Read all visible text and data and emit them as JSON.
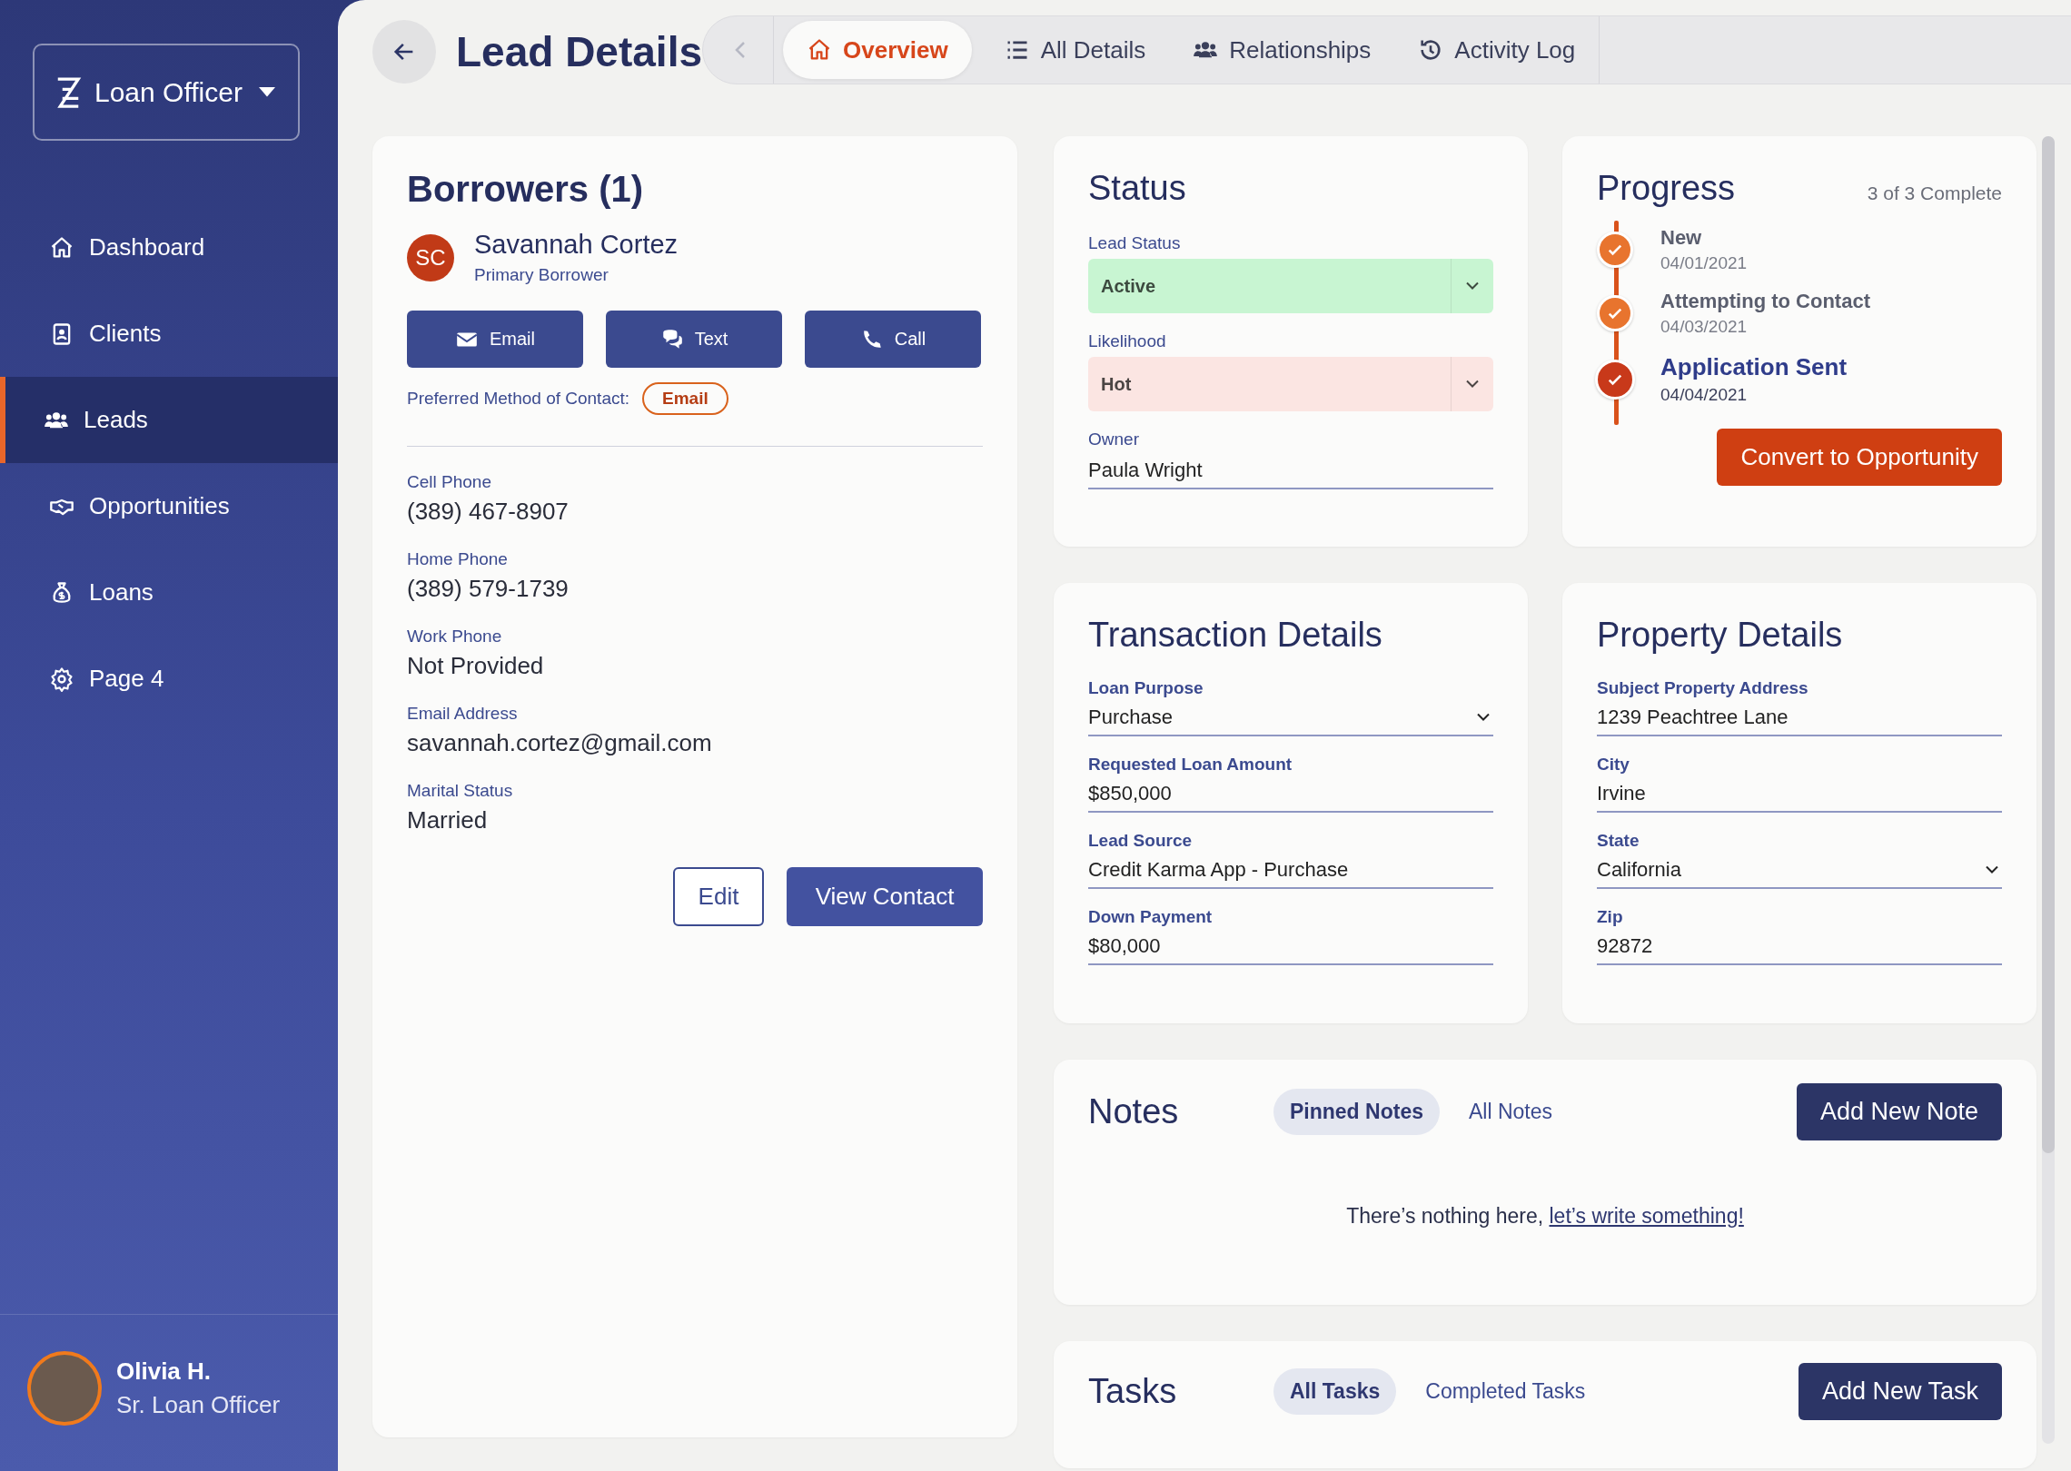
{
  "sidebar": {
    "brand": "Loan Officer",
    "items": [
      {
        "label": "Dashboard",
        "selected": false
      },
      {
        "label": "Clients",
        "selected": false
      },
      {
        "label": "Leads",
        "selected": true
      },
      {
        "label": "Opportunities",
        "selected": false
      },
      {
        "label": "Loans",
        "selected": false
      },
      {
        "label": "Page 4",
        "selected": false
      }
    ],
    "user": {
      "name": "Olivia H.",
      "role": "Sr. Loan Officer"
    }
  },
  "header": {
    "title": "Lead Details",
    "tabs": [
      {
        "label": "Overview",
        "selected": true
      },
      {
        "label": "All Details",
        "selected": false
      },
      {
        "label": "Relationships",
        "selected": false
      },
      {
        "label": "Activity Log",
        "selected": false
      }
    ]
  },
  "borrowers": {
    "title": "Borrowers (1)",
    "initials": "SC",
    "name": "Savannah Cortez",
    "role": "Primary Borrower",
    "actions": [
      "Email",
      "Text",
      "Call"
    ],
    "preferred_label": "Preferred Method of Contact:",
    "preferred_value": "Email",
    "fields": [
      {
        "label": "Cell Phone",
        "value": "(389) 467-8907"
      },
      {
        "label": "Home Phone",
        "value": "(389) 579-1739"
      },
      {
        "label": "Work Phone",
        "value": "Not Provided"
      },
      {
        "label": "Email Address",
        "value": "savannah.cortez@gmail.com"
      },
      {
        "label": "Marital Status",
        "value": "Married"
      }
    ],
    "buttons": [
      {
        "label": "Edit",
        "kind": "outline"
      },
      {
        "label": "View Contact",
        "kind": "primary"
      }
    ]
  },
  "status": {
    "title": "Status",
    "fields": [
      {
        "label": "Lead Status",
        "value": "Active",
        "kind": "colored-select",
        "color": "#c8f5d2"
      },
      {
        "label": "Likelihood",
        "value": "Hot",
        "kind": "colored-select",
        "color": "#fbe5e2"
      },
      {
        "label": "Owner",
        "value": "Paula Wright",
        "kind": "text"
      }
    ]
  },
  "progress": {
    "title": "Progress",
    "summary": "3 of 3 Complete",
    "steps": [
      {
        "label": "New",
        "date": "04/01/2021",
        "checked": true,
        "selected": false
      },
      {
        "label": "Attempting to Contact",
        "date": "04/03/2021",
        "checked": true,
        "selected": false
      },
      {
        "label": "Application Sent",
        "date": "04/04/2021",
        "checked": true,
        "selected": true
      }
    ],
    "action": "Convert to Opportunity"
  },
  "transaction": {
    "title": "Transaction Details",
    "fields": [
      {
        "label": "Loan Purpose",
        "value": "Purchase",
        "kind": "select"
      },
      {
        "label": "Requested Loan Amount",
        "value": "$850,000",
        "kind": "text"
      },
      {
        "label": "Lead Source",
        "value": "Credit Karma App - Purchase",
        "kind": "text"
      },
      {
        "label": "Down Payment",
        "value": "$80,000",
        "kind": "text"
      }
    ]
  },
  "property": {
    "title": "Property Details",
    "fields": [
      {
        "label": "Subject Property Address",
        "value": "1239 Peachtree Lane",
        "kind": "text"
      },
      {
        "label": "City",
        "value": "Irvine",
        "kind": "text"
      },
      {
        "label": "State",
        "value": "California",
        "kind": "select"
      },
      {
        "label": "Zip",
        "value": "92872",
        "kind": "text"
      }
    ]
  },
  "notes": {
    "title": "Notes",
    "tabs": [
      {
        "label": "Pinned Notes",
        "selected": true
      },
      {
        "label": "All Notes",
        "selected": false
      }
    ],
    "action": "Add New Note",
    "empty_text": "There’s nothing here,",
    "empty_link": "let’s write something!"
  },
  "tasks": {
    "title": "Tasks",
    "tabs": [
      {
        "label": "All Tasks",
        "selected": true
      },
      {
        "label": "Completed Tasks",
        "selected": false
      }
    ],
    "action": "Add New Task"
  }
}
